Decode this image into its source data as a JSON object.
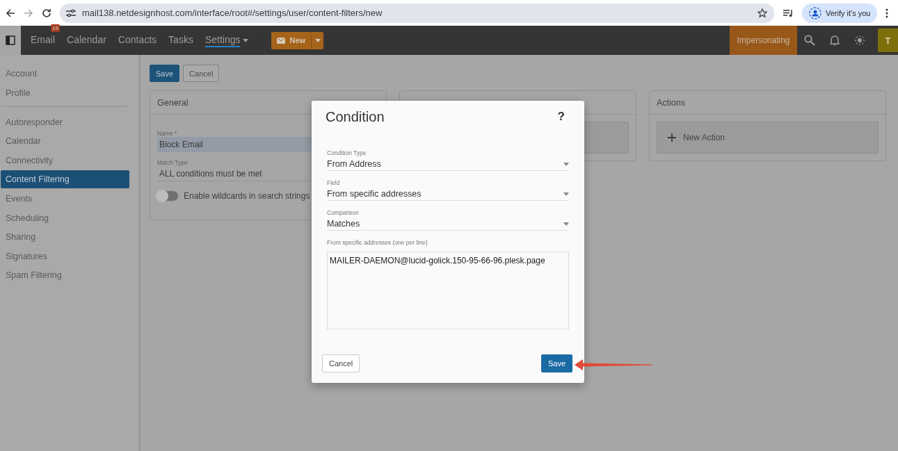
{
  "browser": {
    "url": "mail138.netdesignhost.com/interface/root#/settings/user/content-filters/new",
    "verify_label": "Verify it's you"
  },
  "app_header": {
    "nav": [
      {
        "label": "Email",
        "badge": "19",
        "selected": false,
        "has_menu": false
      },
      {
        "label": "Calendar",
        "selected": false,
        "has_menu": false
      },
      {
        "label": "Contacts",
        "selected": false,
        "has_menu": false
      },
      {
        "label": "Tasks",
        "selected": false,
        "has_menu": false
      },
      {
        "label": "Settings",
        "selected": true,
        "has_menu": true
      }
    ],
    "new_button": "New",
    "impersonating": "Impersonating",
    "avatar": "T"
  },
  "sidebar": {
    "groups": [
      [
        {
          "label": "Account",
          "selected": false
        },
        {
          "label": "Profile",
          "selected": false
        }
      ],
      [
        {
          "label": "Autoresponder",
          "selected": false
        },
        {
          "label": "Calendar",
          "selected": false
        },
        {
          "label": "Connectivity",
          "selected": false
        },
        {
          "label": "Content Filtering",
          "selected": true
        },
        {
          "label": "Events",
          "selected": false
        },
        {
          "label": "Scheduling",
          "selected": false
        },
        {
          "label": "Sharing",
          "selected": false
        },
        {
          "label": "Signatures",
          "selected": false
        },
        {
          "label": "Spam Filtering",
          "selected": false
        }
      ]
    ]
  },
  "toolbar": {
    "save": "Save",
    "cancel": "Cancel"
  },
  "general": {
    "title": "General",
    "name_label": "Name *",
    "name_value": "Block Email",
    "match_label": "Match Type",
    "match_value": "ALL conditions must be met",
    "wildcard": {
      "label": "Enable wildcards in search strings",
      "on": false
    }
  },
  "actions": {
    "title": "Actions",
    "new_action": "New Action"
  },
  "dialog": {
    "title": "Condition",
    "help": "?",
    "fields": [
      {
        "label": "Condition Type",
        "value": "From Address"
      },
      {
        "label": "Field",
        "value": "From specific addresses"
      },
      {
        "label": "Comparison",
        "value": "Matches"
      }
    ],
    "textarea": {
      "label": "From specific addresses (one per line)",
      "value": "MAILER-DAEMON@lucid-golick.150-95-66-96.plesk.page"
    },
    "cancel": "Cancel",
    "save": "Save"
  }
}
